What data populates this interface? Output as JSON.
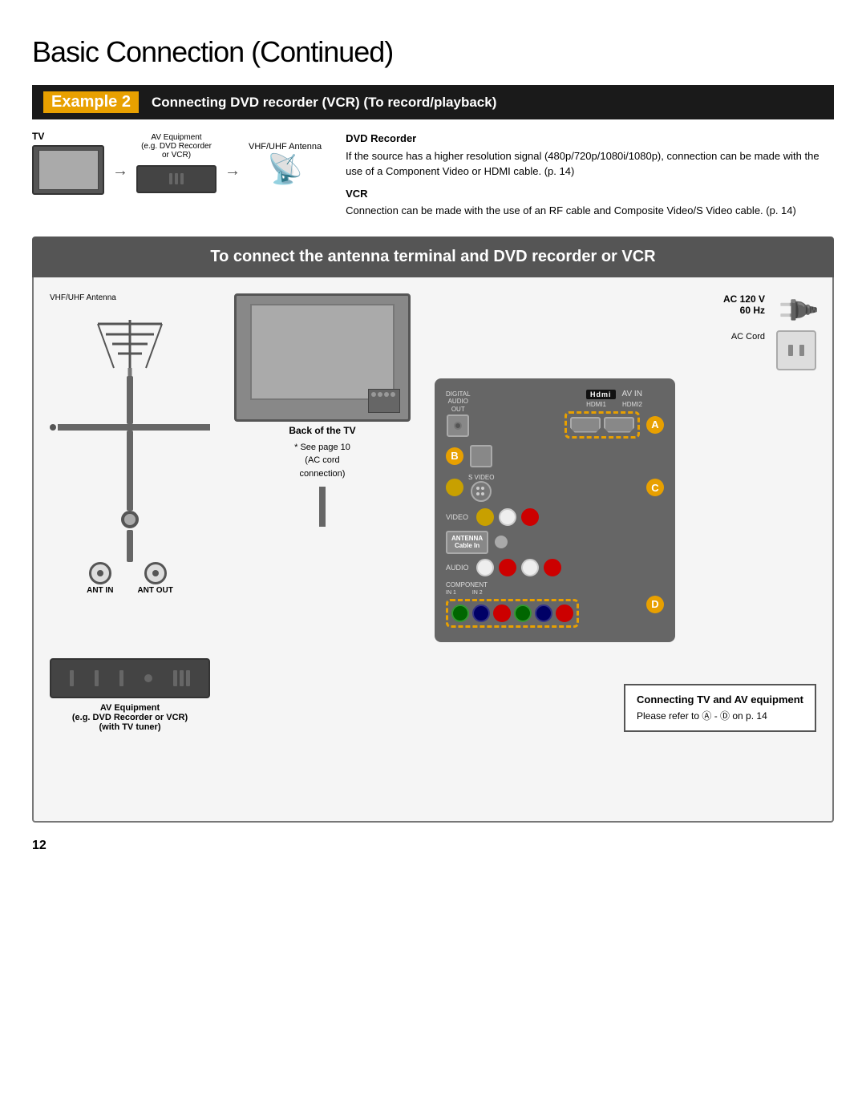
{
  "page": {
    "title_main": "Basic Connection",
    "title_sub": " (Continued)",
    "page_number": "12"
  },
  "example": {
    "number": "Example 2",
    "title": "Connecting DVD recorder (VCR) (To record/playback)"
  },
  "top_diagram": {
    "tv_label": "TV",
    "av_eq_label": "AV Equipment\n(e.g. DVD Recorder\nor VCR)",
    "antenna_label": "VHF/UHF Antenna"
  },
  "dvd_recorder_section": {
    "title": "DVD Recorder",
    "text": "If the source has a higher resolution signal (480p/720p/1080i/1080p), connection can be made with the use of a Component Video or HDMI cable. (p. 14)"
  },
  "vcr_section": {
    "title": "VCR",
    "text": "Connection can be made with the use of an RF cable and Composite Video/S Video cable. (p. 14)"
  },
  "connect_banner": "To connect the antenna terminal and DVD recorder or VCR",
  "diagram": {
    "vhf_antenna_label": "VHF/UHF Antenna",
    "back_of_tv_label": "Back of the TV",
    "see_page_label": "* See page 10\n(AC cord\nconnection)",
    "ac_voltage": "AC 120 V\n60 Hz",
    "ac_cord_label": "AC Cord",
    "antenna_cable_label": "ANTENNA\nCable In",
    "ant_in_label": "ANT IN",
    "ant_out_label": "ANT OUT",
    "av_eq_bottom_label": "AV Equipment\n(e.g. DVD Recorder or VCR)\n(with TV tuner)",
    "indicators": {
      "A": "A",
      "B": "B",
      "C": "C",
      "D": "D"
    },
    "port_labels": {
      "digital_audio_out": "DIGITAL\nAUDIO\nOUT",
      "hdmi": "Hdmi",
      "av_in": "AV IN",
      "hdmi1": "HDMI1",
      "hdmi2": "HDMI2",
      "s_video": "S VIDEO",
      "video": "VIDEO",
      "audio": "AUDIO",
      "component": "COMPONENT",
      "in_1": "IN 1",
      "in_2": "IN 2"
    }
  },
  "connecting_info": {
    "title": "Connecting TV and AV equipment",
    "text": "Please refer to Ⓐ - Ⓓ on p. 14"
  }
}
